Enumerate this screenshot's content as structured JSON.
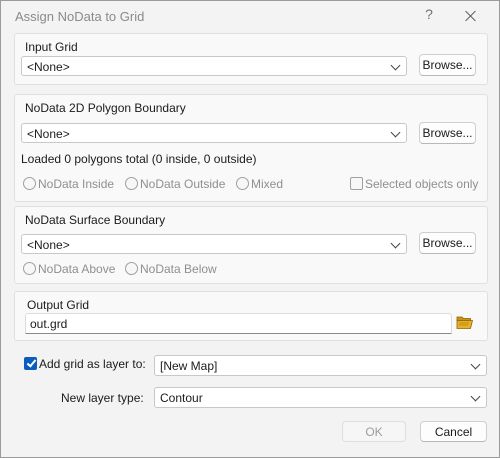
{
  "window": {
    "title": "Assign NoData to Grid",
    "help": "?"
  },
  "input_grid": {
    "label": "Input Grid",
    "value": "<None>",
    "browse": "Browse..."
  },
  "polygon": {
    "label": "NoData 2D Polygon Boundary",
    "value": "<None>",
    "browse": "Browse...",
    "status": "Loaded 0 polygons total (0 inside, 0 outside)",
    "radios": [
      "NoData Inside",
      "NoData Outside",
      "Mixed"
    ],
    "selected_only": "Selected objects only"
  },
  "surface": {
    "label": "NoData Surface Boundary",
    "value": "<None>",
    "browse": "Browse...",
    "radios": [
      "NoData Above",
      "NoData Below"
    ]
  },
  "output": {
    "label": "Output Grid",
    "value": "out.grd"
  },
  "add_layer": {
    "label": "Add grid as layer to:",
    "checked": true,
    "value": "[New Map]"
  },
  "layer_type": {
    "label": "New layer type:",
    "value": "Contour"
  },
  "buttons": {
    "ok": "OK",
    "cancel": "Cancel"
  },
  "colors": {
    "accent": "#0a5cc0",
    "folder": "#e6b325"
  }
}
